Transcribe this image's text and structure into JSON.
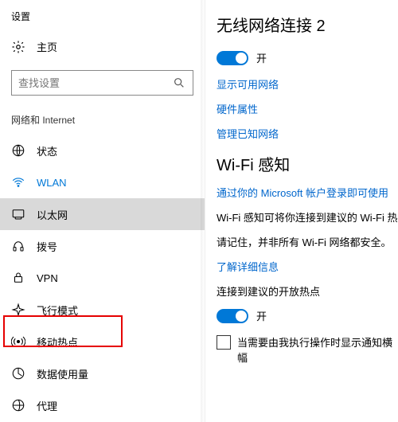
{
  "app_title": "设置",
  "home_label": "主页",
  "search": {
    "placeholder": "查找设置"
  },
  "section_label": "网络和 Internet",
  "nav": [
    {
      "key": "status",
      "label": "状态",
      "icon": "globe-icon"
    },
    {
      "key": "wlan",
      "label": "WLAN",
      "icon": "wifi-icon",
      "active_blue": true
    },
    {
      "key": "ethernet",
      "label": "以太网",
      "icon": "ethernet-icon",
      "selected": true
    },
    {
      "key": "dialup",
      "label": "拨号",
      "icon": "dialup-icon"
    },
    {
      "key": "vpn",
      "label": "VPN",
      "icon": "vpn-icon"
    },
    {
      "key": "airplane",
      "label": "飞行模式",
      "icon": "airplane-icon"
    },
    {
      "key": "hotspot",
      "label": "移动热点",
      "icon": "hotspot-icon",
      "highlighted": true
    },
    {
      "key": "datausage",
      "label": "数据使用量",
      "icon": "data-icon"
    },
    {
      "key": "proxy",
      "label": "代理",
      "icon": "proxy-icon"
    }
  ],
  "main": {
    "heading1": "无线网络连接 2",
    "toggle1_state": "开",
    "link_show_networks": "显示可用网络",
    "link_hw_props": "硬件属性",
    "link_manage_known": "管理已知网络",
    "heading2": "Wi-Fi 感知",
    "link_signin": "通过你的 Microsoft 帐户登录即可使用",
    "body1": "Wi-Fi 感知可将你连接到建议的 Wi-Fi 热",
    "body2": "请记住，并非所有 Wi-Fi 网络都安全。",
    "link_learn_more": "了解详细信息",
    "body3": "连接到建议的开放热点",
    "toggle2_state": "开",
    "checkbox_label": "当需要由我执行操作时显示通知横幅"
  }
}
